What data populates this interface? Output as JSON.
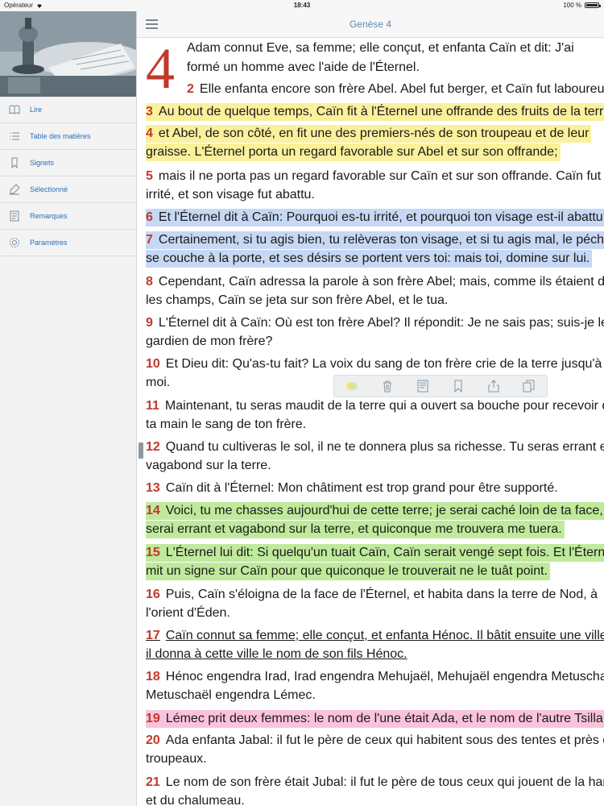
{
  "status_bar": {
    "carrier": "Opérateur",
    "time": "18:43",
    "battery": "100 %"
  },
  "header": {
    "title": "Genèse 4"
  },
  "sidebar": {
    "items": [
      {
        "label": "Lire",
        "icon": "book-icon"
      },
      {
        "label": "Table des matières",
        "icon": "list-icon"
      },
      {
        "label": "Signets",
        "icon": "bookmark-icon"
      },
      {
        "label": "Sélectionné",
        "icon": "highlighter-icon"
      },
      {
        "label": "Remarques",
        "icon": "note-icon"
      },
      {
        "label": "Paramètres",
        "icon": "gear-icon"
      }
    ]
  },
  "chapter": {
    "dropcap": "4",
    "verse1_line1": "Adam connut Eve, sa femme; elle conçut, et enfanta Caïn et dit: J'ai",
    "verse1_line2": "formé un homme avec l'aide de l'Éternel.",
    "verses": [
      {
        "num": "2",
        "lines": [
          "Elle enfanta encore son frère Abel. Abel fut berger, et Caïn fut laboureur."
        ]
      },
      {
        "num": "3",
        "lines": [
          "Au bout de quelque temps, Caïn fit à l'Éternel une offrande des fruits de la terre;"
        ]
      },
      {
        "num": "4",
        "lines": [
          "et Abel, de son côté, en fit une des premiers-nés de son troupeau et de leur",
          "graisse. L'Éternel porta un regard favorable sur Abel et sur son offrande;"
        ]
      },
      {
        "num": "5",
        "lines": [
          "mais il ne porta pas un regard favorable sur Caïn et sur son offrande. Caïn fut très",
          "irrité, et son visage fut abattu."
        ]
      },
      {
        "num": "6",
        "lines": [
          "Et l'Éternel dit à Caïn: Pourquoi es-tu irrité, et pourquoi ton visage est-il abattu?"
        ]
      },
      {
        "num": "7",
        "lines": [
          "Certainement, si tu agis bien, tu relèveras ton visage, et si tu agis mal, le péché",
          "se couche à la porte, et ses désirs se portent vers toi: mais toi, domine sur lui."
        ]
      },
      {
        "num": "8",
        "lines": [
          "Cependant, Caïn adressa la parole à son frère Abel; mais, comme ils étaient dans",
          "les champs, Caïn se jeta sur son frère Abel, et le tua."
        ]
      },
      {
        "num": "9",
        "lines": [
          "L'Éternel dit à Caïn: Où est ton frère Abel? Il répondit: Je ne sais pas; suis-je le",
          "gardien de mon frère?"
        ]
      },
      {
        "num": "10",
        "lines": [
          "Et Dieu dit: Qu'as-tu fait? La voix du sang de ton frère crie de la terre jusqu'à",
          "moi."
        ]
      },
      {
        "num": "11",
        "lines": [
          "Maintenant, tu seras maudit de la terre qui a ouvert sa bouche pour recevoir de",
          "ta main le sang de ton frère."
        ]
      },
      {
        "num": "12",
        "lines": [
          "Quand tu cultiveras le sol, il ne te donnera plus sa richesse. Tu seras errant et",
          "vagabond sur la terre."
        ]
      },
      {
        "num": "13",
        "lines": [
          "Caïn dit à l'Éternel: Mon châtiment est trop grand pour être supporté."
        ]
      },
      {
        "num": "14",
        "lines": [
          "Voici, tu me chasses aujourd'hui de cette terre; je serai caché loin de ta face, je",
          "serai errant et vagabond sur la terre, et quiconque me trouvera me tuera."
        ]
      },
      {
        "num": "15",
        "lines": [
          "L'Éternel lui dit: Si quelqu'un tuait Caïn, Caïn serait vengé sept fois. Et l'Éternel",
          "mit un signe sur Caïn pour que quiconque le trouverait ne le tuât point."
        ]
      },
      {
        "num": "16",
        "lines": [
          "Puis, Caïn s'éloigna de la face de l'Éternel, et habita dans la terre de Nod, à",
          "l'orient d'Éden."
        ]
      },
      {
        "num": "17",
        "lines": [
          "Caïn connut sa femme; elle conçut, et enfanta Hénoc. Il bâtit ensuite une ville, et",
          "il donna à cette ville le nom de son fils Hénoc."
        ]
      },
      {
        "num": "18",
        "lines": [
          "Hénoc engendra Irad, Irad engendra Mehujaël, Mehujaël engendra Metuschaël, et",
          "Metuschaël engendra Lémec."
        ]
      },
      {
        "num": "19",
        "lines": [
          "Lémec prit deux femmes: le nom de l'une était Ada, et le nom de l'autre Tsilla."
        ]
      },
      {
        "num": "20",
        "lines": [
          "Ada enfanta Jabal: il fut le père de ceux qui habitent sous des tentes et près des",
          "troupeaux."
        ]
      },
      {
        "num": "21",
        "lines": [
          "Le nom de son frère était Jubal: il fut le père de tous ceux qui jouent de la harpe",
          "et du chalumeau."
        ]
      }
    ]
  },
  "toolbar": {
    "tools": [
      "color-picker-icon",
      "trash-icon",
      "note-icon",
      "bookmark-icon",
      "share-icon",
      "copy-icon"
    ]
  },
  "colors": {
    "accent": "#2c6fb3",
    "verse_number": "#c0392b",
    "highlight_yellow": "#fbf09b",
    "highlight_blue": "#c7d8f4",
    "highlight_green": "#bfea9c",
    "highlight_pink": "#fac3db"
  }
}
